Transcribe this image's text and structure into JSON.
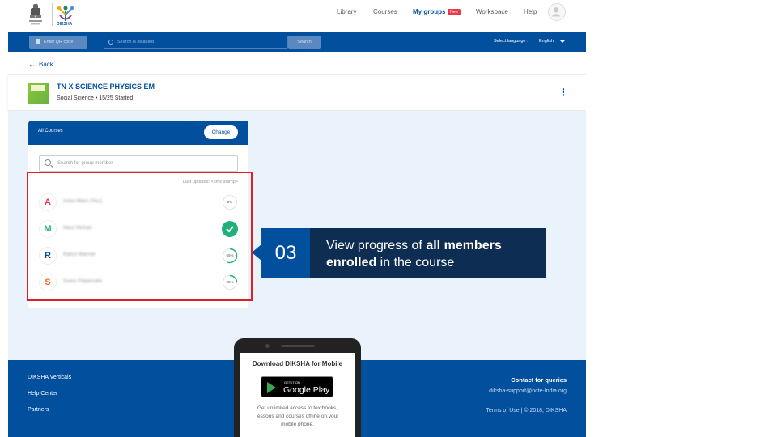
{
  "header": {
    "logo_text": "DIKSHA",
    "nav": [
      "Library",
      "Courses",
      "My groups",
      "Workspace",
      "Help"
    ],
    "new_badge": "New"
  },
  "searchbar": {
    "qr_label": "Enter QR code",
    "search_placeholder": "Search is disabled",
    "search_button": "Search",
    "language_label": "Select language :",
    "language_value": "English"
  },
  "back_label": "Back",
  "course": {
    "title": "TN X SCIENCE PHYSICS EM",
    "subtitle": "Social Science • 15/25 Started"
  },
  "card": {
    "title": "All Courses",
    "change_label": "Change",
    "search_placeholder": "Search for group member",
    "last_updated": "Last updated: <time stamp>",
    "members": [
      {
        "initial": "A",
        "name": "Anka Mani (You)",
        "progress": 0,
        "progress_label": "0%",
        "color": "#e8394c",
        "completed": false
      },
      {
        "initial": "M",
        "name": "Mani Mohan",
        "progress": 100,
        "progress_label": "",
        "color": "#20b07a",
        "completed": true
      },
      {
        "initial": "R",
        "name": "Rahul Warrier",
        "progress": 55,
        "progress_label": "55%",
        "color": "#024f9d",
        "completed": false
      },
      {
        "initial": "S",
        "name": "Sukru Patamuke",
        "progress": 25,
        "progress_label": "25%",
        "color": "#f06a1d",
        "completed": false
      }
    ]
  },
  "callout": {
    "number": "03",
    "text_1": "View progress of ",
    "text_bold_1": "all members",
    "text_bold_2": "enrolled",
    "text_2": " in the course"
  },
  "footer": {
    "links": [
      "DIKSHA Verticals",
      "Help Center",
      "Partners"
    ],
    "contact_title": "Contact for queries",
    "contact_email": "diksha-support@ncte-India.org",
    "terms": "Terms of Use | © 2018, DIKSHA"
  },
  "phone": {
    "title": "Download DIKSHA for Mobile",
    "badge_small": "GET IT ON",
    "badge_big": "Google Play",
    "desc": "Get unlimited access to textbooks, lessons and courses offline on your mobile phone."
  },
  "colors": {
    "brand_blue": "#024f9d",
    "callout_dark": "#0e2d52",
    "highlight_red": "#e01f26",
    "success_green": "#20b07a"
  }
}
